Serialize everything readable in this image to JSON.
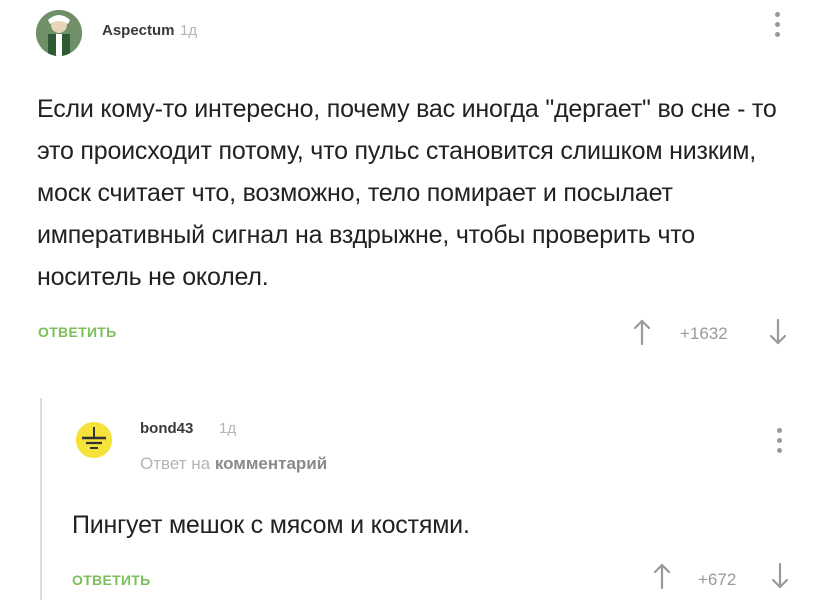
{
  "comments": [
    {
      "username": "Aspectum",
      "time": "1д",
      "text": "Если кому-то интересно, почему вас иногда \"дергает\" во сне - то это происходит потому, что пульс становится слишком низким, моск считает что, возможно, тело помирает и посылает императивный сигнал на вздрыжне, чтобы проверить что носитель не околел.",
      "reply_label": "ОТВЕТИТЬ",
      "rating": "+1632"
    },
    {
      "username": "bond43",
      "time": "1д",
      "reply_to_prefix": "Ответ на",
      "reply_to_link": "комментарий",
      "text": "Пингует мешок с мясом и костями.",
      "reply_label": "ОТВЕТИТЬ",
      "rating": "+672"
    }
  ],
  "colors": {
    "accent_green": "#7cbf5a",
    "muted_gray": "#b5b5b5",
    "avatar_yellow": "#f5e23a"
  },
  "icons": {
    "vote_up": "arrow-up-icon",
    "vote_down": "arrow-down-icon",
    "menu": "more-vertical-icon"
  }
}
